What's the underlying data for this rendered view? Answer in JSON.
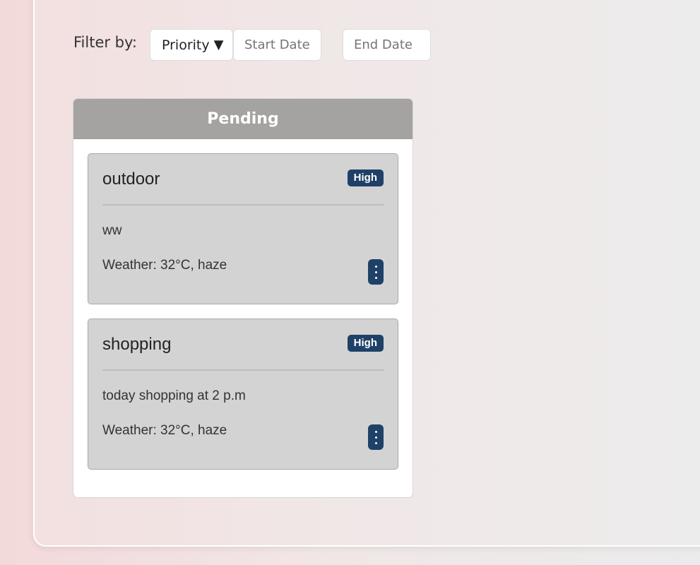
{
  "filter": {
    "label": "Filter by:",
    "priority_selected": "Priority",
    "caret": "▼",
    "start_date_placeholder": "Start Date",
    "end_date_placeholder": "End Date"
  },
  "column": {
    "title": "Pending",
    "header_color": "#a4a3a1",
    "cards": [
      {
        "title": "outdoor",
        "priority": "High",
        "description": "ww",
        "weather": "Weather: 32°C, haze"
      },
      {
        "title": "shopping",
        "priority": "High",
        "description": "today shopping at 2 p.m",
        "weather": "Weather: 32°C, haze"
      }
    ]
  },
  "colors": {
    "badge": "#1f4168",
    "card_bg": "#d3d3d3"
  },
  "icons": {
    "card_menu": "vertical-ellipsis-icon",
    "dropdown": "caret-down-icon"
  }
}
